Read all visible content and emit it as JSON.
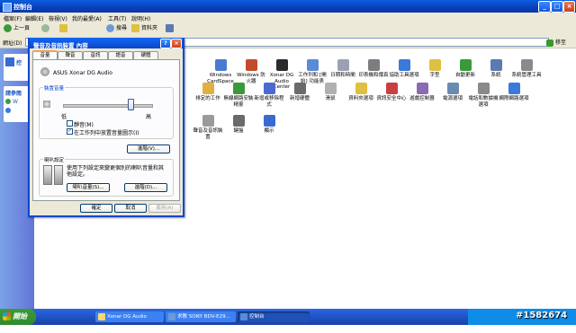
{
  "window": {
    "title": "控制台"
  },
  "menubar": [
    "檔案(F)",
    "編輯(E)",
    "檢視(V)",
    "我的最愛(A)",
    "工具(T)",
    "說明(H)"
  ],
  "toolbar": {
    "back": "上一頁",
    "search": "搜尋",
    "folders": "資料夾"
  },
  "address": {
    "label": "網址(D)",
    "value": "控制台",
    "go": "移至"
  },
  "left_pane": {
    "header": "控",
    "section": "請參閱",
    "item": "W"
  },
  "cp_items": [
    {
      "label": "Windows CardSpace",
      "color": "#4a7bd0"
    },
    {
      "label": "Windows 防火牆",
      "color": "#c44b2a"
    },
    {
      "label": "Xonar DG Audio Center",
      "color": "#2b2b2b"
    },
    {
      "label": "工作列和 [開始] 功能表",
      "color": "#5a8ad8"
    },
    {
      "label": "日期和時間",
      "color": "#9aa2b2"
    },
    {
      "label": "印表機和傳真",
      "color": "#7d7d7d"
    },
    {
      "label": "協助工具選項",
      "color": "#3a7ad8"
    },
    {
      "label": "字型",
      "color": "#e0c040"
    },
    {
      "label": "自動更新",
      "color": "#3a9a3a"
    },
    {
      "label": "系統",
      "color": "#5a7ab0"
    },
    {
      "label": "系統管理工具",
      "color": "#8a8a8a"
    },
    {
      "label": "排定的工作",
      "color": "#e0b040"
    },
    {
      "label": "無線網路安裝精靈",
      "color": "#3a9a3a"
    },
    {
      "label": "新增或移除程式",
      "color": "#4a6ad0"
    },
    {
      "label": "新增硬體",
      "color": "#6a6a6a"
    },
    {
      "label": "滑鼠",
      "color": "#b0b0b0"
    },
    {
      "label": "資料夾選項",
      "color": "#e0c040"
    },
    {
      "label": "資訊安全中心",
      "color": "#c84040"
    },
    {
      "label": "遊戲控制器",
      "color": "#8a6ab0"
    },
    {
      "label": "電源選項",
      "color": "#6a8ab0"
    },
    {
      "label": "電話和數據機選項",
      "color": "#8a8a8a"
    },
    {
      "label": "網際網路選項",
      "color": "#3a7ad8"
    },
    {
      "label": "聲音及音訊裝置",
      "color": "#9a9a9a"
    },
    {
      "label": "鍵盤",
      "color": "#6a6a6a"
    },
    {
      "label": "顯示",
      "color": "#3a6ad0"
    }
  ],
  "dialog": {
    "title": "聲音及音訊裝置 內容",
    "tabs": [
      "音量",
      "聲音",
      "音訊",
      "語音",
      "硬體"
    ],
    "device": "ASUS Xonar DG Audio",
    "volume_group": "裝置音量",
    "slider_low": "低",
    "slider_high": "高",
    "mute_label": "靜音(M)",
    "tray_label": "在工作列中放置音量圖示(I)",
    "advanced_button": "進階(V)...",
    "speaker_group": "喇叭設定",
    "speaker_desc": "使用下列設定來變更個別的喇叭音量和其他設定。",
    "speaker_volume_button": "喇叭音量(S)...",
    "speaker_advanced_button": "進階(D)...",
    "ok": "確定",
    "cancel": "取消",
    "apply": "套用(A)"
  },
  "taskbar": {
    "start": "開始",
    "tasks": [
      "Xonar DG Audio Center",
      "求教 SONY BDV-E29...",
      "控制台"
    ]
  },
  "watermark": "#1582674"
}
